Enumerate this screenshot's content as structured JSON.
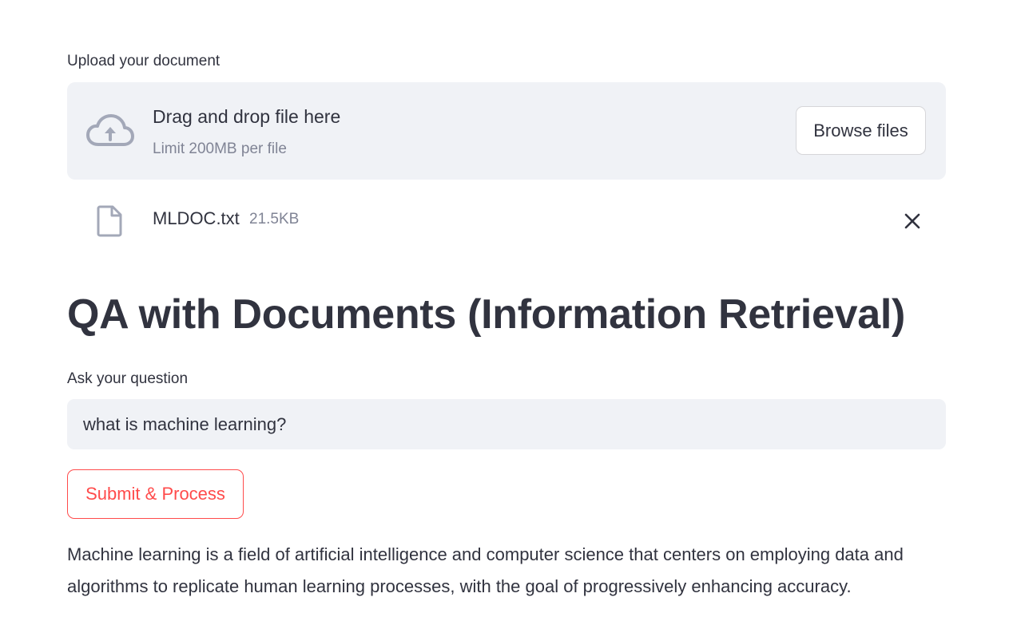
{
  "uploader": {
    "label": "Upload your document",
    "drop_title": "Drag and drop file here",
    "limit_text": "Limit 200MB per file",
    "browse_label": "Browse files",
    "icon": "cloud-upload-icon"
  },
  "uploaded_file": {
    "name": "MLDOC.txt",
    "size": "21.5KB",
    "icon": "file-icon",
    "remove_icon": "close-icon"
  },
  "page": {
    "title": "QA with Documents (Information Retrieval)"
  },
  "question": {
    "label": "Ask your question",
    "value": "what is machine learning?"
  },
  "submit": {
    "label": "Submit & Process"
  },
  "answer": {
    "text": "Machine learning is a field of artificial intelligence and computer science that centers on employing data and algorithms to replicate human learning processes, with the goal of progressively enhancing accuracy."
  },
  "colors": {
    "text": "#31333f",
    "muted": "#808495",
    "panel": "#f0f2f6",
    "accent": "#ff4b4b",
    "icon": "#a3a8b8"
  }
}
